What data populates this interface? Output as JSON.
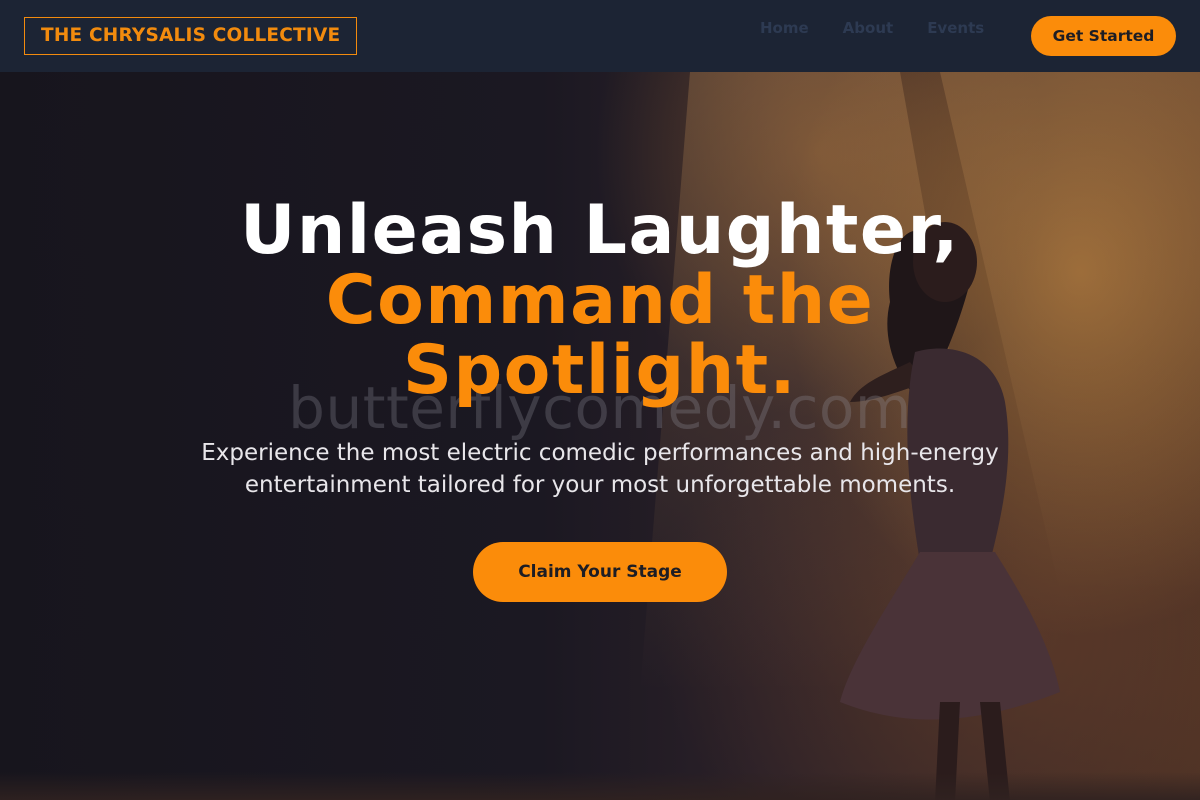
{
  "nav": {
    "logo": "THE CHRYSALIS COLLECTIVE",
    "links": [
      "Home",
      "About",
      "Events"
    ],
    "cta": "Get Started"
  },
  "hero": {
    "headline_line1": "Unleash Laughter,",
    "headline_line2": "Command the Spotlight.",
    "watermark": "butterflycomedy.com",
    "subtitle": "Experience the most electric comedic performances and high-energy entertainment tailored for your most unforgettable moments.",
    "cta": "Claim Your Stage"
  },
  "colors": {
    "accent": "#fb8c0a",
    "nav_bg": "#1c2434",
    "hero_bg": "#17151d"
  }
}
